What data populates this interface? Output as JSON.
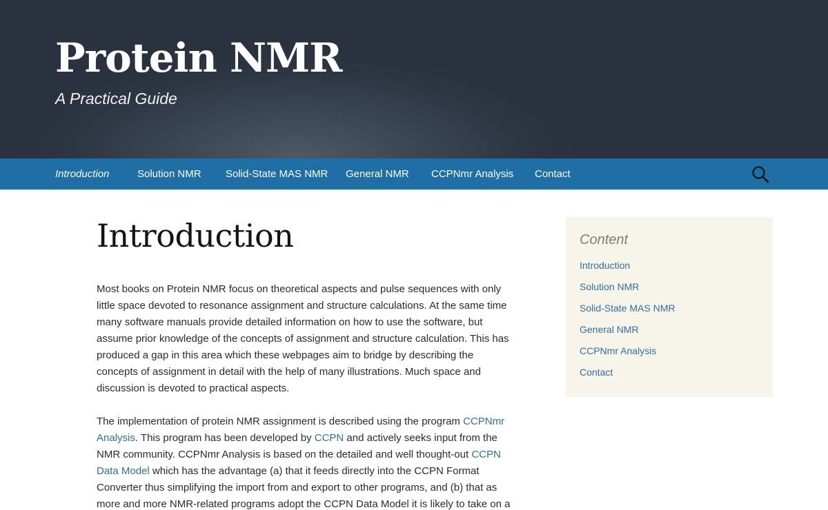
{
  "header": {
    "title": "Protein NMR",
    "tagline": "A Practical Guide"
  },
  "nav": {
    "items": [
      {
        "label": "Introduction",
        "active": true
      },
      {
        "label": "Solution NMR"
      },
      {
        "label": "Solid-State MAS NMR"
      },
      {
        "label": "General NMR"
      },
      {
        "label": "CCPNmr Analysis"
      },
      {
        "label": "Contact"
      }
    ],
    "search_icon": "search-icon"
  },
  "main": {
    "title": "Introduction",
    "para1": "Most books on Protein NMR focus on theoretical aspects and pulse sequences with only little space devoted to resonance assignment and structure calculations. At the same time many software manuals provide detailed information on how to use the software, but assume prior knowledge of the concepts of assignment and structure calculation. This has produced a gap in this area which these webpages aim to bridge by describing the concepts of assignment in detail with the help of many illustrations. Much space and discussion is devoted to practical aspects.",
    "para2": {
      "t1": "The implementation of protein NMR assignment is described using the program ",
      "link1": "CCPNmr Analysis",
      "t2": ". This program has been developed by ",
      "link2": "CCPN",
      "t3": " and actively seeks input from the NMR community. CCPNmr Analysis is based on the detailed and well thought-out ",
      "link3": "CCPN Data Model",
      "t4": " which has the advantage (a) that it feeds directly into the CCPN Format Converter thus simplifying the import from and export to other programs, and (b) that as more and more NMR-related programs adopt the CCPN Data Model it is likely to take on a"
    }
  },
  "sidebar": {
    "title": "Content",
    "links": [
      "Introduction",
      "Solution NMR",
      "Solid-State MAS NMR",
      "General NMR",
      "CCPNmr Analysis",
      "Contact"
    ]
  },
  "colors": {
    "nav_bg": "#1f6fa6",
    "link": "#2f6f9f",
    "sidebar_bg": "#f7f5ea"
  }
}
